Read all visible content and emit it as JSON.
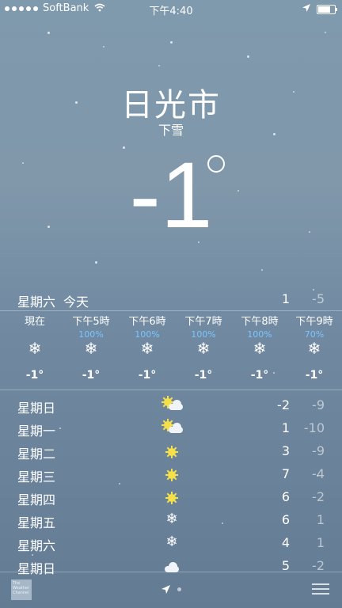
{
  "status_bar": {
    "carrier": "SoftBank",
    "time": "下午4:40"
  },
  "location": {
    "city": "日光市",
    "condition": "下雪",
    "temperature": "-1",
    "unit_symbol": "°"
  },
  "today": {
    "day": "星期六",
    "label": "今天",
    "high": "1",
    "low": "-5"
  },
  "hourly": [
    {
      "time": "現在",
      "precip": "",
      "icon": "snowflake-icon",
      "temp": "-1°"
    },
    {
      "time": "下午5時",
      "precip": "100%",
      "icon": "snowflake-icon",
      "temp": "-1°"
    },
    {
      "time": "下午6時",
      "precip": "100%",
      "icon": "snowflake-icon",
      "temp": "-1°"
    },
    {
      "time": "下午7時",
      "precip": "100%",
      "icon": "snowflake-icon",
      "temp": "-1°"
    },
    {
      "time": "下午8時",
      "precip": "100%",
      "icon": "snowflake-icon",
      "temp": "-1°"
    },
    {
      "time": "下午9時",
      "precip": "70%",
      "icon": "snowflake-icon",
      "temp": "-1°"
    }
  ],
  "daily": [
    {
      "day": "星期日",
      "icon": "partly-cloudy-icon",
      "high": "-2",
      "low": "-9"
    },
    {
      "day": "星期一",
      "icon": "partly-cloudy-icon",
      "high": "1",
      "low": "-10"
    },
    {
      "day": "星期二",
      "icon": "sun-icon",
      "high": "3",
      "low": "-9"
    },
    {
      "day": "星期三",
      "icon": "sun-icon",
      "high": "7",
      "low": "-4"
    },
    {
      "day": "星期四",
      "icon": "sun-icon",
      "high": "6",
      "low": "-2"
    },
    {
      "day": "星期五",
      "icon": "snowflake-icon",
      "high": "6",
      "low": "1"
    },
    {
      "day": "星期六",
      "icon": "snowflake-icon",
      "high": "4",
      "low": "1"
    },
    {
      "day": "星期日",
      "icon": "cloud-icon",
      "high": "5",
      "low": "-2"
    }
  ],
  "footer": {
    "logo_text": "The Weather Channel"
  },
  "colors": {
    "precip": "#7cc5ff",
    "sun": "#f5e04a"
  }
}
